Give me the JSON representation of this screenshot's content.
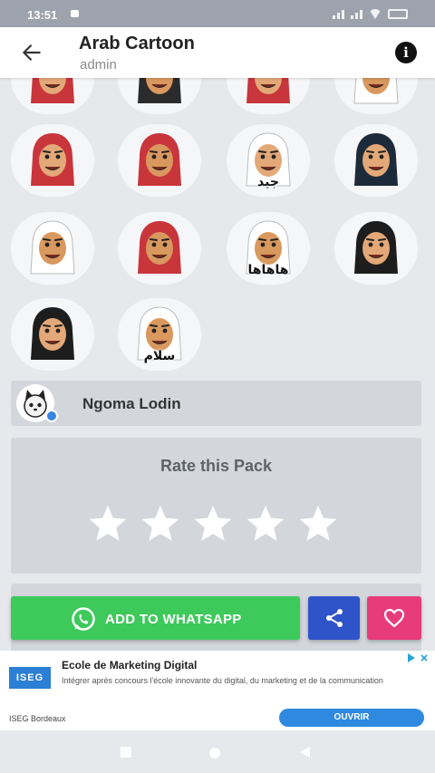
{
  "status_bar": {
    "time": "13:51"
  },
  "app_bar": {
    "title": "Arab Cartoon",
    "subtitle": "admin"
  },
  "stickers": [
    {
      "id": "sticker-1",
      "icon": "arab-cartoon-sticker-icon",
      "skin": "#e3a878",
      "scarf": "#c8353b",
      "text": ""
    },
    {
      "id": "sticker-2",
      "icon": "arab-cartoon-sticker-icon",
      "skin": "#d9985e",
      "scarf": "#2b2b2b",
      "text": ""
    },
    {
      "id": "sticker-3",
      "icon": "arab-cartoon-sticker-icon",
      "skin": "#e3a878",
      "scarf": "#c8353b",
      "text": ""
    },
    {
      "id": "sticker-4",
      "icon": "arab-cartoon-sticker-icon",
      "skin": "#d9985e",
      "scarf": "#ffffff",
      "text": ""
    },
    {
      "id": "sticker-5",
      "icon": "arab-cartoon-sticker-icon",
      "skin": "#e3a878",
      "scarf": "#c8353b",
      "text": ""
    },
    {
      "id": "sticker-6",
      "icon": "arab-cartoon-sticker-icon",
      "skin": "#d9985e",
      "scarf": "#c8353b",
      "text": ""
    },
    {
      "id": "sticker-7",
      "icon": "arab-cartoon-sticker-icon",
      "skin": "#e3a878",
      "scarf": "#ffffff",
      "text": "جيد"
    },
    {
      "id": "sticker-8",
      "icon": "arab-cartoon-sticker-icon",
      "skin": "#e3a878",
      "scarf": "#1d2a3a",
      "text": ""
    },
    {
      "id": "sticker-9",
      "icon": "arab-cartoon-sticker-icon",
      "skin": "#d9985e",
      "scarf": "#ffffff",
      "text": ""
    },
    {
      "id": "sticker-10",
      "icon": "arab-cartoon-sticker-icon",
      "skin": "#d9985e",
      "scarf": "#c8353b",
      "text": ""
    },
    {
      "id": "sticker-11",
      "icon": "arab-cartoon-sticker-icon",
      "skin": "#d9985e",
      "scarf": "#ffffff",
      "text": "هاهاها"
    },
    {
      "id": "sticker-12",
      "icon": "arab-cartoon-sticker-icon",
      "skin": "#e3a878",
      "scarf": "#1d1d1d",
      "text": ""
    },
    {
      "id": "sticker-13",
      "icon": "arab-cartoon-sticker-icon",
      "skin": "#e3a878",
      "scarf": "#1d1d1d",
      "text": ""
    },
    {
      "id": "sticker-14",
      "icon": "arab-cartoon-sticker-icon",
      "skin": "#d9985e",
      "scarf": "#ffffff",
      "text": "سلام"
    }
  ],
  "author": {
    "name": "Ngoma Lodin",
    "avatar_icon": "cat-avatar-icon",
    "badge_icon": "verified-badge-icon"
  },
  "rating": {
    "label": "Rate this Pack",
    "stars": 5,
    "icon": "star-icon"
  },
  "actions": {
    "add_label": "ADD TO WHATSAPP",
    "add_icon": "whatsapp-icon",
    "share_icon": "share-icon",
    "favorite_icon": "heart-icon"
  },
  "ad": {
    "logo_text": "ISEG",
    "title": "Ecole de Marketing Digital",
    "description": "Intégrer après concours l'école innovante du digital, du marketing et de la communication",
    "advertiser": "ISEG Bordeaux",
    "cta": "OUVRIR"
  },
  "colors": {
    "whatsapp_green": "#3ec95b",
    "share_blue": "#2f53c9",
    "favorite_pink": "#e83b7a",
    "panel_gray": "#d3d7dc"
  }
}
